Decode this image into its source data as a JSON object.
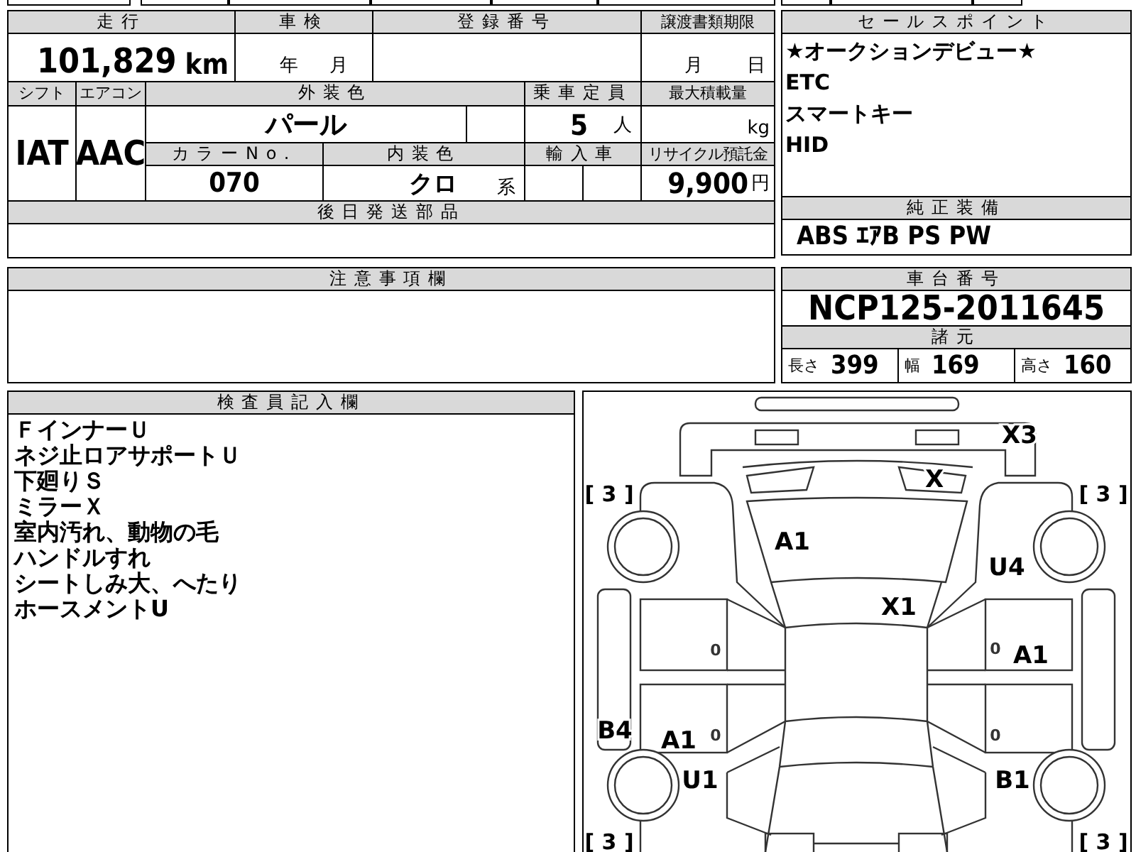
{
  "top_table": {
    "mileage": {
      "label": "走行",
      "value": "101,829",
      "unit": "km"
    },
    "inspection": {
      "label": "車検",
      "year_unit": "年",
      "month_unit": "月"
    },
    "registration": {
      "label": "登録番号"
    },
    "transfer_deadline": {
      "label": "譲渡書類期限",
      "month_unit": "月",
      "day_unit": "日"
    },
    "shift": {
      "label": "シフト",
      "value": "IAT"
    },
    "aircon": {
      "label": "エアコン",
      "value": "AAC"
    },
    "exterior_color": {
      "label": "外装色",
      "value": "パール"
    },
    "capacity": {
      "label": "乗車定員",
      "value": "5",
      "unit": "人"
    },
    "max_load": {
      "label": "最大積載量",
      "unit": "kg"
    },
    "color_no": {
      "label": "カラーNo.",
      "value": "070"
    },
    "interior_color": {
      "label": "内装色",
      "value": "クロ",
      "unit": "系"
    },
    "import": {
      "label": "輸入車"
    },
    "recycle_fee": {
      "label": "リサイクル預託金",
      "value": "9,900",
      "unit": "円"
    },
    "later_parts": {
      "label": "後日発送部品"
    }
  },
  "sales_points": {
    "label": "セールスポイント",
    "items": [
      "★オークションデビュー★",
      "ETC",
      "スマートキー",
      "HID"
    ]
  },
  "standard_equipment": {
    "label": "純正装備",
    "value": "ABS ｴｱB PS PW"
  },
  "notices": {
    "label": "注意事項欄"
  },
  "chassis": {
    "label": "車台番号",
    "value": "NCP125-2011645"
  },
  "specs": {
    "label": "諸元",
    "items": [
      {
        "label": "長さ",
        "value": "399"
      },
      {
        "label": "幅",
        "value": "169"
      },
      {
        "label": "高さ",
        "value": "160"
      }
    ]
  },
  "inspector_notes": {
    "label": "検査員記入欄",
    "lines": [
      "ＦインナーＵ",
      "ネジ止ロアサポートＵ",
      "下廻りＳ",
      "ミラーＸ",
      "室内汚れ、動物の毛",
      "ハンドルすれ",
      "シートしみ大、へたり",
      "ホースメントU"
    ]
  },
  "diagram": {
    "marks": [
      {
        "kind": "code",
        "text": "X3"
      },
      {
        "kind": "code",
        "text": "X"
      },
      {
        "kind": "code",
        "text": "A1"
      },
      {
        "kind": "code",
        "text": "U4"
      },
      {
        "kind": "code",
        "text": "X1"
      },
      {
        "kind": "code",
        "text": "A1"
      },
      {
        "kind": "code",
        "text": "B4"
      },
      {
        "kind": "code",
        "text": "A1"
      },
      {
        "kind": "code",
        "text": "U1"
      },
      {
        "kind": "code",
        "text": "B1"
      },
      {
        "kind": "tire",
        "text": "[ 3 ]"
      },
      {
        "kind": "tire",
        "text": "[ 3 ]"
      },
      {
        "kind": "tire",
        "text": "[ 3 ]"
      },
      {
        "kind": "tire",
        "text": "[ 3 ]"
      },
      {
        "kind": "door",
        "text": "0"
      },
      {
        "kind": "door",
        "text": "0"
      },
      {
        "kind": "door",
        "text": "0"
      },
      {
        "kind": "door",
        "text": "0"
      }
    ]
  }
}
